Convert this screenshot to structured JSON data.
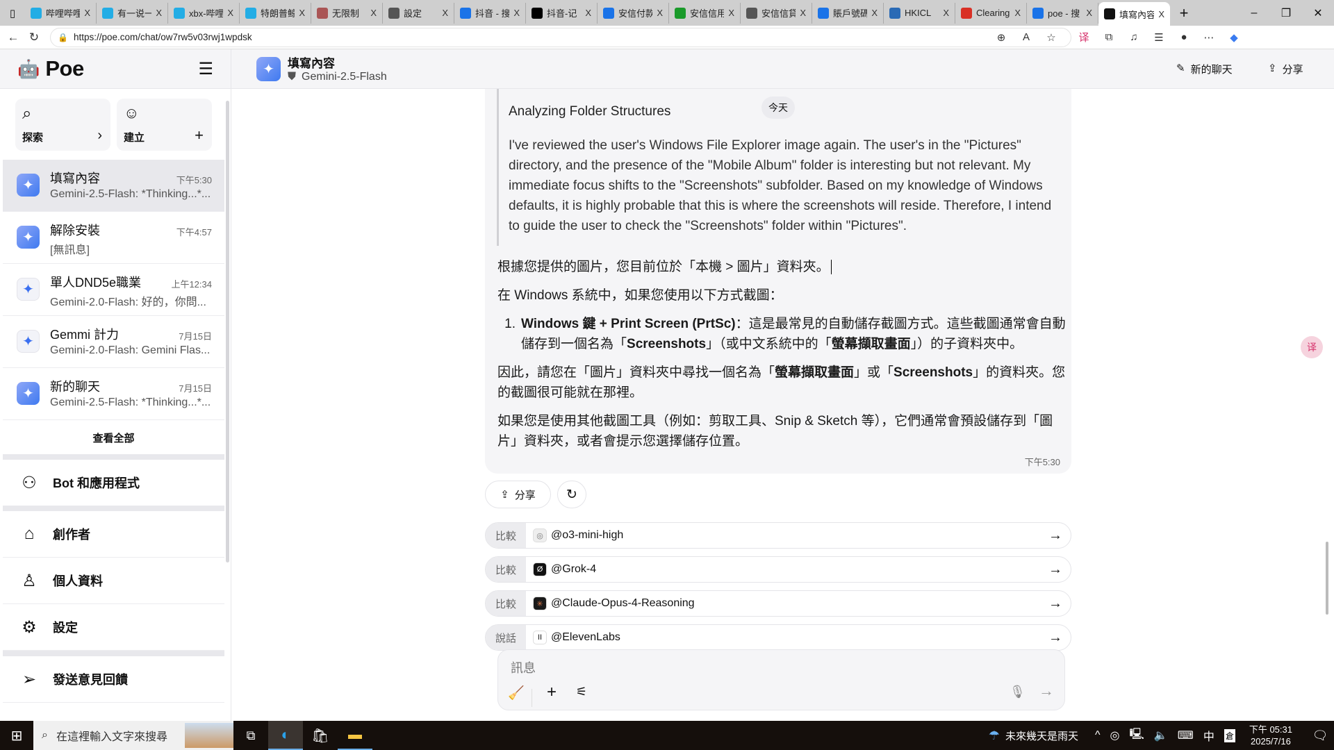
{
  "browser": {
    "tabs": [
      {
        "label": "哔哩哔哩",
        "icon": "bilibili-icon",
        "color": "#23ade5"
      },
      {
        "label": "有一说一",
        "icon": "bilibili-icon",
        "color": "#23ade5"
      },
      {
        "label": "xbx-哔哩",
        "icon": "bilibili-icon",
        "color": "#23ade5"
      },
      {
        "label": "特朗普鲸",
        "icon": "bilibili-icon",
        "color": "#23ade5"
      },
      {
        "label": "无限制",
        "icon": "anime-avatar-icon",
        "color": "#a55"
      },
      {
        "label": "設定",
        "icon": "gear-icon",
        "color": "#555"
      },
      {
        "label": "抖音 - 搜",
        "icon": "search-icon",
        "color": "#1a73e8"
      },
      {
        "label": "抖音-记",
        "icon": "tiktok-icon",
        "color": "#000"
      },
      {
        "label": "安信付款",
        "icon": "search-icon",
        "color": "#1a73e8"
      },
      {
        "label": "安信信用",
        "icon": "green-doc-icon",
        "color": "#1a9a2a"
      },
      {
        "label": "安信信貸",
        "icon": "globe-icon",
        "color": "#555"
      },
      {
        "label": "賬戶號碼",
        "icon": "search-icon",
        "color": "#1a73e8"
      },
      {
        "label": "HKICL",
        "icon": "hkicl-icon",
        "color": "#2a6ab5"
      },
      {
        "label": "Clearing",
        "icon": "pdf-icon",
        "color": "#d93025"
      },
      {
        "label": "poe - 搜",
        "icon": "search-icon",
        "color": "#1a73e8"
      },
      {
        "label": "填寫內容",
        "icon": "poe-icon",
        "color": "#111",
        "active": true
      }
    ],
    "close_glyph": "X",
    "new_tab": "+",
    "url": "https://poe.com/chat/ow7rw5v03rwj1wpdsk"
  },
  "sidebar": {
    "logo": "Poe",
    "explore": "探索",
    "create": "建立",
    "chats": [
      {
        "title": "填寫內容",
        "time": "下午5:30",
        "snippet": "Gemini-2.5-Flash: *Thinking...*...",
        "selected": true
      },
      {
        "title": "解除安裝",
        "time": "下午4:57",
        "snippet": "[無訊息]"
      },
      {
        "title": "單人DND5e職業",
        "time": "上午12:34",
        "snippet": "Gemini-2.0-Flash: 好的，你問...",
        "light": true
      },
      {
        "title": "Gemmi 計力",
        "time": "7月15日",
        "snippet": "Gemini-2.0-Flash: Gemini Flas...",
        "light": true
      },
      {
        "title": "新的聊天",
        "time": "7月15日",
        "snippet": "Gemini-2.5-Flash: *Thinking...*..."
      }
    ],
    "view_all": "查看全部",
    "menu": {
      "bots": "Bot 和應用程式",
      "creators": "創作者",
      "profile": "個人資料",
      "settings": "設定",
      "feedback": "發送意見回饋"
    }
  },
  "header": {
    "title": "填寫內容",
    "bot": "Gemini-2.5-Flash",
    "new_chat": "新的聊天",
    "share": "分享"
  },
  "conversation": {
    "date_pill": "今天",
    "thinking_title": "Analyzing Folder Structures",
    "thinking_body": "I've reviewed the user's Windows File Explorer image again. The user's in the \"Pictures\" directory, and the presence of the \"Mobile Album\" folder is interesting but not relevant. My immediate focus shifts to the \"Screenshots\" subfolder. Based on my knowledge of Windows defaults, it is highly probable that this is where the screenshots will reside. Therefore, I intend to guide the user to check the \"Screenshots\" folder within \"Pictures\".",
    "p1": "根據您提供的圖片，您目前位於「本機 > 圖片」資料夾。",
    "p2": "在 Windows 系統中，如果您使用以下方式截圖：",
    "li_num": "1.",
    "li_bold": "Windows 鍵 + Print Screen (PrtSc)",
    "li_a": "：這是最常見的自動儲存截圖方式。這些截圖通常會自動儲存到一個名為「",
    "li_b": "Screenshots",
    "li_c": "」（或中文系統中的「",
    "li_d": "螢幕擷取畫面",
    "li_e": "」）的子資料夾中。",
    "p3_a": "因此，請您在「圖片」資料夾中尋找一個名為「",
    "p3_b": "螢幕擷取畫面",
    "p3_c": "」或「",
    "p3_d": "Screenshots",
    "p3_e": "」的資料夾。您的截圖很可能就在那裡。",
    "p4": "如果您是使用其他截圖工具（例如：剪取工具、Snip & Sketch 等），它們通常會預設儲存到「圖片」資料夾，或者會提示您選擇儲存位置。",
    "time": "下午5:30",
    "share": "分享"
  },
  "suggestions": [
    {
      "kind": "比較",
      "bot": "@o3-mini-high",
      "icon": "openai-icon",
      "bg": "#eee",
      "fg": "#777",
      "glyph": "◎"
    },
    {
      "kind": "比較",
      "bot": "@Grok-4",
      "icon": "grok-icon",
      "bg": "#111",
      "fg": "#fff",
      "glyph": "Ø"
    },
    {
      "kind": "比較",
      "bot": "@Claude-Opus-4-Reasoning",
      "icon": "claude-icon",
      "bg": "#1a1a1a",
      "fg": "#e07a4a",
      "glyph": "✳"
    },
    {
      "kind": "說話",
      "bot": "@ElevenLabs",
      "icon": "elevenlabs-icon",
      "bg": "#fff",
      "fg": "#111",
      "glyph": "II"
    }
  ],
  "composer": {
    "placeholder": "訊息"
  },
  "taskbar": {
    "search_placeholder": "在這裡輸入文字來搜尋",
    "weather": "未來幾天是雨天",
    "ime": "中",
    "ime2": "倉",
    "time": "下午 05:31",
    "date": "2025/7/16"
  }
}
